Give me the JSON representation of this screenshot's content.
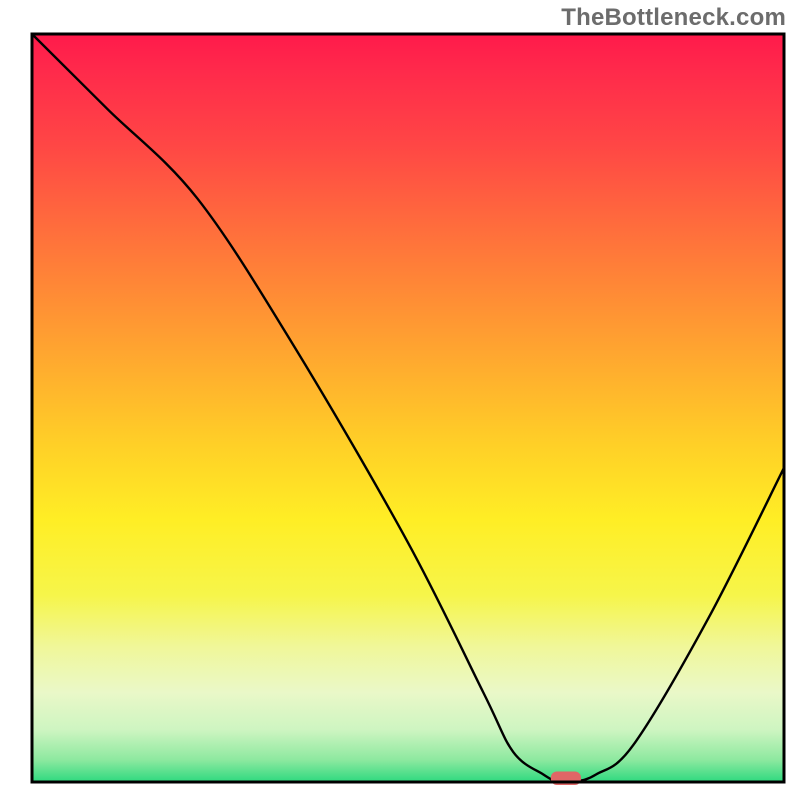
{
  "watermark": "TheBottleneck.com",
  "chart_data": {
    "type": "line",
    "title": "",
    "xlabel": "",
    "ylabel": "",
    "xlim": [
      0,
      100
    ],
    "ylim": [
      0,
      100
    ],
    "grid": false,
    "legend": false,
    "series": [
      {
        "name": "curve",
        "x": [
          0,
          10,
          22,
          35,
          50,
          60,
          64,
          68,
          70,
          72,
          75,
          80,
          90,
          100
        ],
        "values": [
          100,
          90,
          78,
          58,
          32,
          12,
          4,
          1,
          0,
          0,
          1,
          5,
          22,
          42
        ]
      }
    ],
    "marker": {
      "x": 71,
      "y": 0.5,
      "width": 4,
      "height": 1.8,
      "color": "#e06666"
    },
    "gradient_bands": [
      {
        "y": 100,
        "color": "#ff1a4b"
      },
      {
        "y": 95,
        "color": "#ff2a4b"
      },
      {
        "y": 85,
        "color": "#ff4745"
      },
      {
        "y": 75,
        "color": "#ff6a3d"
      },
      {
        "y": 65,
        "color": "#ff8c35"
      },
      {
        "y": 55,
        "color": "#ffae2e"
      },
      {
        "y": 45,
        "color": "#ffd027"
      },
      {
        "y": 35,
        "color": "#ffee25"
      },
      {
        "y": 25,
        "color": "#f6f54a"
      },
      {
        "y": 18,
        "color": "#f0f79a"
      },
      {
        "y": 12,
        "color": "#eaf8c8"
      },
      {
        "y": 7,
        "color": "#cef5c1"
      },
      {
        "y": 3,
        "color": "#8ee9a0"
      },
      {
        "y": 0,
        "color": "#2ed97f"
      }
    ]
  }
}
